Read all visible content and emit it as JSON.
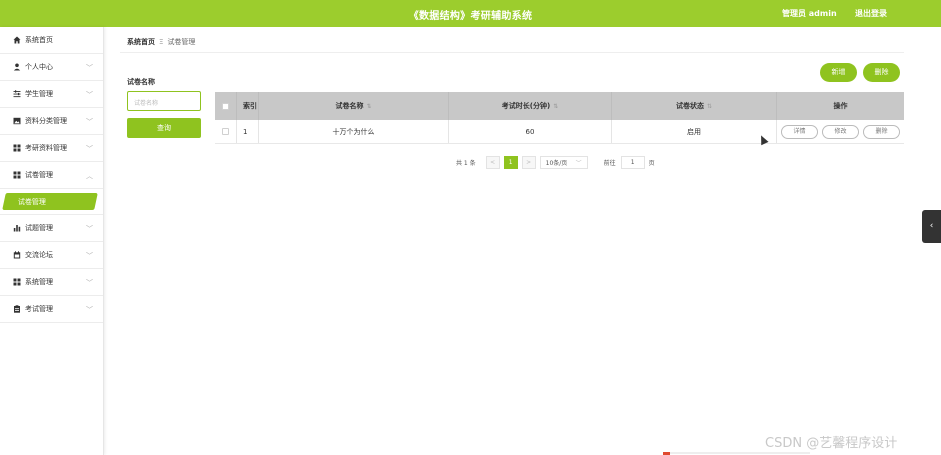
{
  "header": {
    "title": "《数据结构》考研辅助系统",
    "user": "管理员 admin",
    "logout": "退出登录"
  },
  "sidebar": {
    "items": [
      {
        "label": "系统首页",
        "icon": "home-icon",
        "has_arrow": false
      },
      {
        "label": "个人中心",
        "icon": "user-icon",
        "has_arrow": true
      },
      {
        "label": "学生管理",
        "icon": "sliders-icon",
        "has_arrow": true
      },
      {
        "label": "资料分类管理",
        "icon": "image-icon",
        "has_arrow": true
      },
      {
        "label": "考研资料管理",
        "icon": "grid-icon",
        "has_arrow": true
      },
      {
        "label": "试卷管理",
        "icon": "grid-icon",
        "has_arrow": true,
        "expanded": true
      },
      {
        "label": "试题管理",
        "icon": "bar-chart-icon",
        "has_arrow": true
      },
      {
        "label": "交流论坛",
        "icon": "calendar-icon",
        "has_arrow": true
      },
      {
        "label": "系统管理",
        "icon": "grid-icon",
        "has_arrow": true
      },
      {
        "label": "考试管理",
        "icon": "clipboard-icon",
        "has_arrow": true
      }
    ],
    "active_sub": "试卷管理"
  },
  "breadcrumb": {
    "home": "系统首页",
    "separator": "Ξ",
    "current": "试卷管理"
  },
  "search": {
    "label": "试卷名称",
    "placeholder": "试卷名称",
    "button": "查询"
  },
  "actions": {
    "add": "新增",
    "delete": "删除"
  },
  "table": {
    "headers": {
      "index": "索引",
      "name": "试卷名称",
      "duration": "考试时长(分钟)",
      "status": "试卷状态",
      "ops": "操作"
    },
    "rows": [
      {
        "index": "1",
        "name": "十万个为什么",
        "duration": "60",
        "status": "启用"
      }
    ],
    "row_actions": {
      "detail": "详情",
      "edit": "修改",
      "delete": "删除"
    }
  },
  "pagination": {
    "total": "共 1 条",
    "prev": "<",
    "current": "1",
    "next": ">",
    "page_size": "10条/页",
    "goto_label": "前往",
    "goto_value": "1",
    "goto_suffix": "页"
  },
  "watermark": "CSDN @艺馨程序设计",
  "colors": {
    "accent": "#9ccd2d",
    "accent_dark": "#8fc31f",
    "table_header": "#c8c8c8"
  }
}
